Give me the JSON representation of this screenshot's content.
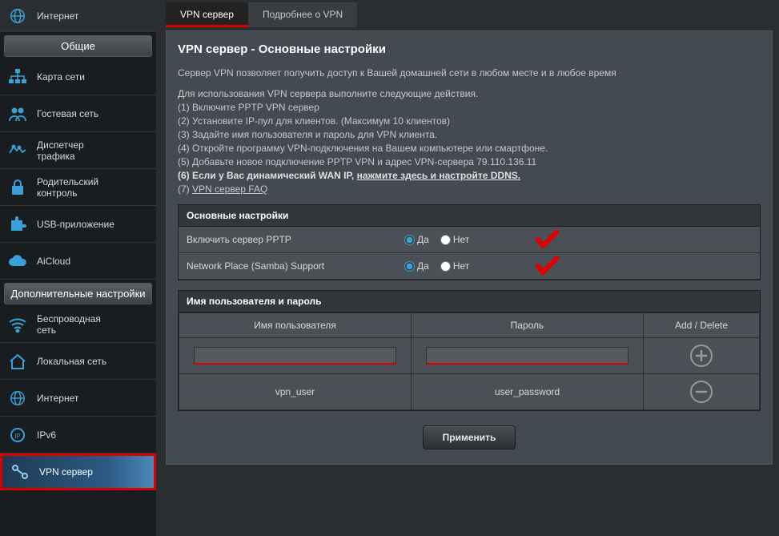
{
  "sidebar": {
    "section_general": "Общие",
    "section_advanced": "Дополнительные настройки",
    "items": {
      "internet_top": "Интернет",
      "network_map": "Карта сети",
      "guest_net": "Гостевая сеть",
      "traffic_mgr_a": "Диспетчер",
      "traffic_mgr_b": "трафика",
      "parental_a": "Родительский",
      "parental_b": "контроль",
      "usb_app": "USB-приложение",
      "aicloud": "AiCloud",
      "wireless_a": "Беспроводная",
      "wireless_b": "сеть",
      "lan": "Локальная сеть",
      "wan": "Интернет",
      "ipv6": "IPv6",
      "vpn": "VPN сервер"
    }
  },
  "tabs": {
    "vpn_server": "VPN сервер",
    "vpn_details": "Подробнее о VPN"
  },
  "page": {
    "title": "VPN сервер - Основные настройки",
    "intro": "Сервер VPN позволяет получить доступ к Вашей домашней сети в любом месте и в любое время",
    "steps_intro": "Для использования VPN сервера выполните следующие действия.",
    "s1": "(1) Включите PPTP VPN сервер",
    "s2": "(2) Установите IP-пул для клиентов. (Максимум 10 клиентов)",
    "s3": "(3) Задайте имя пользователя и пароль для VPN клиента.",
    "s4": "(4) Откройте программу VPN-подключения на Вашем компьютере или смартфоне.",
    "s5": "(5) Добавьте новое подключение PPTP VPN и адрес VPN-сервера 79.110.136.11",
    "s6a": "(6) Если у Вас динамический WAN IP, ",
    "s6b": "нажмите здесь и настройте DDNS.",
    "s7": "(7) ",
    "s7link": "VPN сервер FAQ"
  },
  "section_basic": {
    "header": "Основные настройки",
    "enable_pptp_label": "Включить сервер PPTP",
    "samba_label": "Network Place (Samba) Support",
    "yes": "Да",
    "no": "Нет"
  },
  "section_users": {
    "header": "Имя пользователя и пароль",
    "col_user": "Имя пользователя",
    "col_pass": "Пароль",
    "col_action": "Add / Delete",
    "sample_user": "vpn_user",
    "sample_pass": "user_password"
  },
  "apply": "Применить"
}
